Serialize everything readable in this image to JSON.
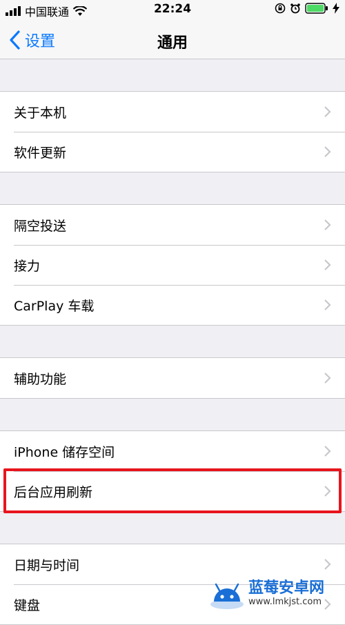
{
  "status_bar": {
    "carrier": "中国联通",
    "time": "22:24"
  },
  "nav": {
    "back_label": "设置",
    "title": "通用"
  },
  "groups": [
    {
      "rows": [
        {
          "label": "关于本机"
        },
        {
          "label": "软件更新"
        }
      ]
    },
    {
      "rows": [
        {
          "label": "隔空投送"
        },
        {
          "label": "接力"
        },
        {
          "label": "CarPlay 车载"
        }
      ]
    },
    {
      "rows": [
        {
          "label": "辅助功能"
        }
      ]
    },
    {
      "rows": [
        {
          "label": "iPhone 储存空间"
        },
        {
          "label": "后台应用刷新"
        }
      ]
    },
    {
      "rows": [
        {
          "label": "日期与时间"
        },
        {
          "label": "键盘"
        }
      ]
    }
  ],
  "highlighted_row": "后台应用刷新",
  "watermark": {
    "title": "蓝莓安卓网",
    "url": "www.lmkjst.com"
  },
  "colors": {
    "accent": "#0a7aff",
    "highlight": "#e8141d",
    "background": "#efeff4",
    "battery": "#4cd964"
  }
}
